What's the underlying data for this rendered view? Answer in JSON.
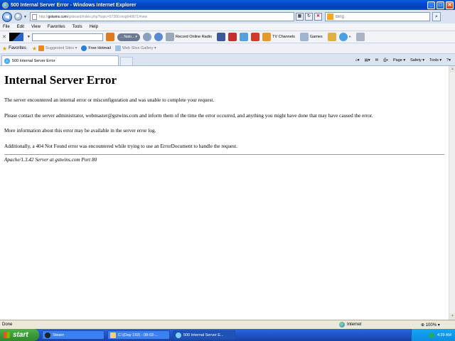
{
  "window": {
    "title": "500 Internal Server Error - Windows Internet Explorer"
  },
  "address": {
    "url_prefix": "http://",
    "url_host": "gstwins.com",
    "url_path": "/gsboard/index.php?topic=57280.msg640671#new",
    "search_placeholder": "Bing"
  },
  "menu": {
    "items": [
      "File",
      "Edit",
      "View",
      "Favorites",
      "Tools",
      "Help"
    ]
  },
  "toolbar": {
    "radio_label": "Record Online Radio",
    "tv_label": "TV Channels",
    "games_label": "Games",
    "player_label": "... Nato... ▾"
  },
  "favorites": {
    "label": "Favorites",
    "suggested": "Suggested Sites ▾",
    "hotmail": "Free Hotmail",
    "gallery": "Web Slice Gallery ▾"
  },
  "tab": {
    "label": "500 Internal Server Error"
  },
  "commands": {
    "page": "Page ▾",
    "safety": "Safety ▾",
    "tools": "Tools ▾"
  },
  "page": {
    "heading": "Internal Server Error",
    "p1": "The server encountered an internal error or misconfiguration and was unable to complete your request.",
    "p2": "Please contact the server administrator, webmaster@gstwins.com and inform them of the time the error occurred, and anything you might have done that may have caused the error.",
    "p3": "More information about this error may be available in the server error log.",
    "p4": "Additionally, a 404 Not Found error was encountered while trying to use an ErrorDocument to handle the request.",
    "footer": "Apache/1.3.42 Server at gstwins.com Port 80"
  },
  "status": {
    "text": "Done",
    "zone": "Internet",
    "zoom": "⊕ 100% ▾"
  },
  "taskbar": {
    "start": "start",
    "tasks": [
      "Steam",
      "C:\\(Day 193) - 08-02-...",
      "500 Internal Server E..."
    ],
    "clock": "4:39 AM"
  },
  "colors": {
    "titlebar": "#0546c8",
    "taskbar": "#245edb",
    "start": "#3c9a37"
  }
}
